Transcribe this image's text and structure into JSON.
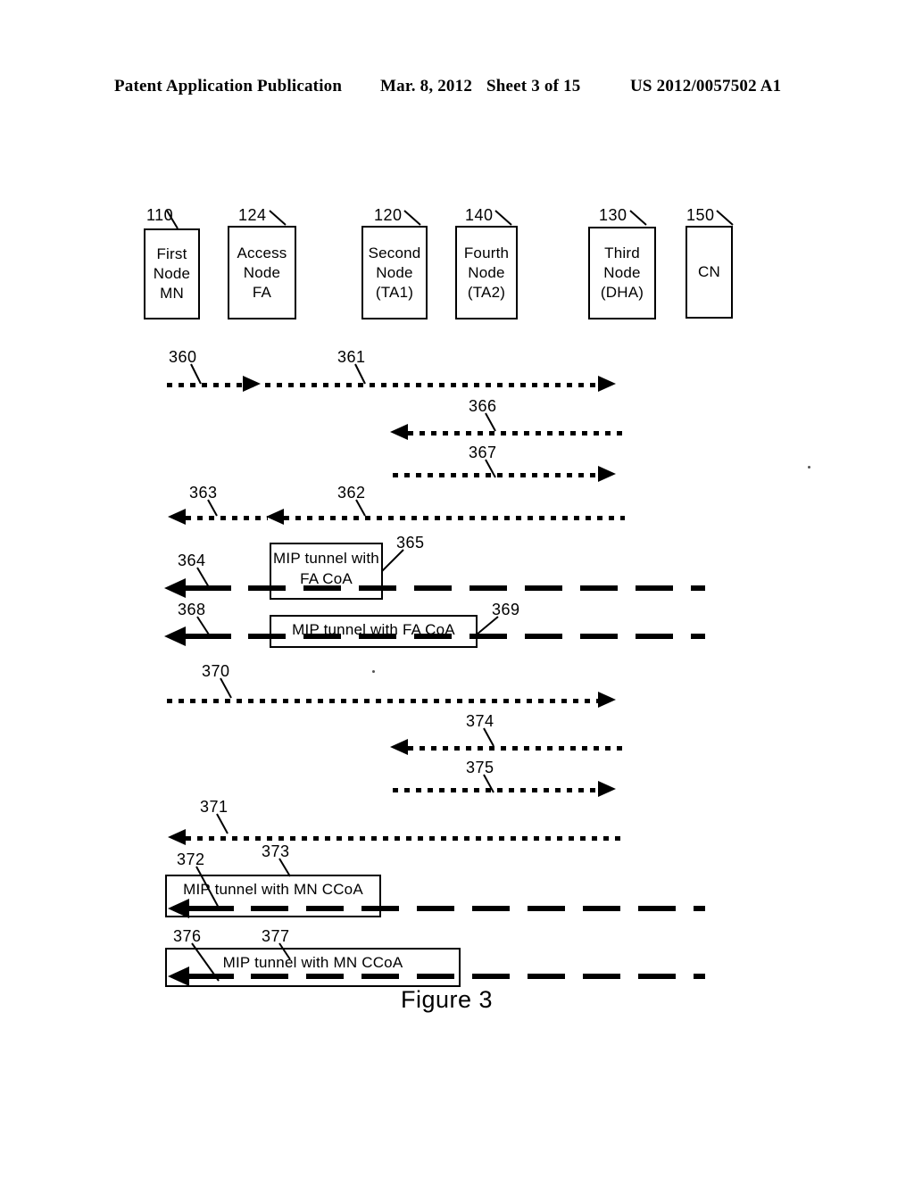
{
  "header": {
    "left": "Patent Application Publication",
    "date": "Mar. 8, 2012",
    "sheet": "Sheet 3 of 15",
    "publication_number": "US 2012/0057502 A1"
  },
  "figure": {
    "caption": "Figure 3"
  },
  "nodes": [
    {
      "ref": "110",
      "lines": [
        "First",
        "Node",
        "MN"
      ]
    },
    {
      "ref": "124",
      "lines": [
        "Access",
        "Node",
        "FA"
      ]
    },
    {
      "ref": "120",
      "lines": [
        "Second",
        "Node",
        "(TA1)"
      ]
    },
    {
      "ref": "140",
      "lines": [
        "Fourth",
        "Node",
        "(TA2)"
      ]
    },
    {
      "ref": "130",
      "lines": [
        "Third",
        "Node",
        "(DHA)"
      ]
    },
    {
      "ref": "150",
      "lines": [
        "CN"
      ]
    }
  ],
  "refs": {
    "r360": "360",
    "r361": "361",
    "r366": "366",
    "r367": "367",
    "r363": "363",
    "r362": "362",
    "r364": "364",
    "r365": "365",
    "r368": "368",
    "r369": "369",
    "r370": "370",
    "r374": "374",
    "r375": "375",
    "r371": "371",
    "r372": "372",
    "r373": "373",
    "r376": "376",
    "r377": "377"
  },
  "tunnels": {
    "t365_line1": "MIP tunnel with",
    "t365_line2": "FA CoA",
    "t369": "MIP tunnel with FA CoA",
    "t373": "MIP tunnel with MN CCoA",
    "t377": "MIP tunnel with MN CCoA"
  },
  "colors": {
    "ink": "#000000",
    "page": "#ffffff"
  }
}
